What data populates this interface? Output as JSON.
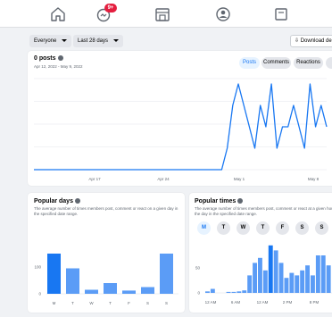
{
  "nav": {
    "items": [
      {
        "icon": "home-icon"
      },
      {
        "icon": "notifications-icon",
        "badge": "9+"
      },
      {
        "icon": "marketplace-icon"
      },
      {
        "icon": "groups-icon"
      },
      {
        "icon": "pages-icon"
      }
    ]
  },
  "filters": {
    "audience": "Everyone",
    "range": "Last 28 days",
    "download": "Download de"
  },
  "posts_card": {
    "title": "0 posts",
    "date_range": "Apr 12, 2022 - May 9, 2022",
    "tabs": [
      "Posts",
      "Comments",
      "Reactions",
      "A"
    ],
    "active_tab": "Posts"
  },
  "days_card": {
    "title": "Popular days",
    "description": "The average number of times members post, comment or react on a given day in the specified date range."
  },
  "times_card": {
    "title": "Popular times",
    "description": "The average number of times members post, comment or react at a given hou the day in the specified date range.",
    "day_buttons": [
      "M",
      "T",
      "W",
      "T",
      "F",
      "S",
      "S"
    ],
    "active_day": "M"
  },
  "colors": {
    "accent": "#1877f2",
    "bar_light": "#5b9cf6",
    "bar_dark": "#1877f2"
  },
  "chart_data": [
    {
      "type": "line",
      "x_ticks": [
        "Apr 17",
        "Apr 24",
        "May 1",
        "May 8"
      ],
      "series": [
        {
          "values": [
            0,
            0,
            0,
            0,
            0,
            0,
            0,
            0,
            0,
            0,
            0,
            0,
            0,
            0,
            0,
            0,
            0,
            0,
            0,
            0,
            0,
            0,
            0,
            0,
            0,
            0,
            0,
            0,
            0,
            0,
            0,
            0,
            0,
            0,
            0,
            1,
            3,
            4,
            3,
            2,
            1,
            3,
            2,
            4,
            1,
            2,
            2,
            3,
            2,
            1,
            4,
            2,
            3,
            2
          ]
        }
      ],
      "grid": true
    },
    {
      "type": "bar",
      "categories": [
        "M",
        "T",
        "W",
        "T",
        "F",
        "S",
        "S"
      ],
      "values": [
        150,
        95,
        15,
        40,
        12,
        25,
        150
      ],
      "ylim": [
        0,
        200
      ],
      "y_ticks": [
        "0",
        "100"
      ],
      "highlighted": 0
    },
    {
      "type": "bar",
      "x_ticks": [
        "12 AM",
        "6 AM",
        "12 AM",
        "2 PM",
        "8 PM"
      ],
      "y_ticks": [
        "0",
        "50"
      ],
      "ylim": [
        0,
        100
      ],
      "values": [
        3,
        8,
        0,
        0,
        2,
        2,
        3,
        5,
        35,
        60,
        70,
        45,
        95,
        85,
        60,
        30,
        40,
        35,
        45,
        55,
        35,
        75,
        75,
        55
      ],
      "highlighted": 12
    }
  ]
}
